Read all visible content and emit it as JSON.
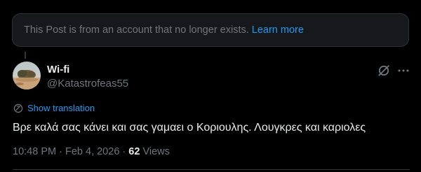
{
  "notice": {
    "text": "This Post is from an account that no longer exists.",
    "link": "Learn more"
  },
  "author": {
    "display_name": "Wi-fi",
    "handle": "@Katastrofeas55",
    "avatar_icon": "avatar-photo"
  },
  "actions": {
    "grok_icon": "grok-icon",
    "more_icon": "more-icon"
  },
  "translation": {
    "icon": "globe-icon",
    "label": "Show translation"
  },
  "tweet": {
    "text": "Βρε καλά σας κάνει και σας γαμαει ο Κοριουλης. Λουγκρες και καριολες"
  },
  "meta": {
    "time": "10:48 PM",
    "separator1": "·",
    "date": "Feb 4, 2026",
    "separator2": "·",
    "views_count": "62",
    "views_label": "Views"
  },
  "colors": {
    "background": "#000000",
    "accent": "#1d9bf0",
    "text_primary": "#e7e9ea",
    "text_secondary": "#71767b",
    "border": "#2f3336",
    "notice_bg": "#16181c"
  }
}
